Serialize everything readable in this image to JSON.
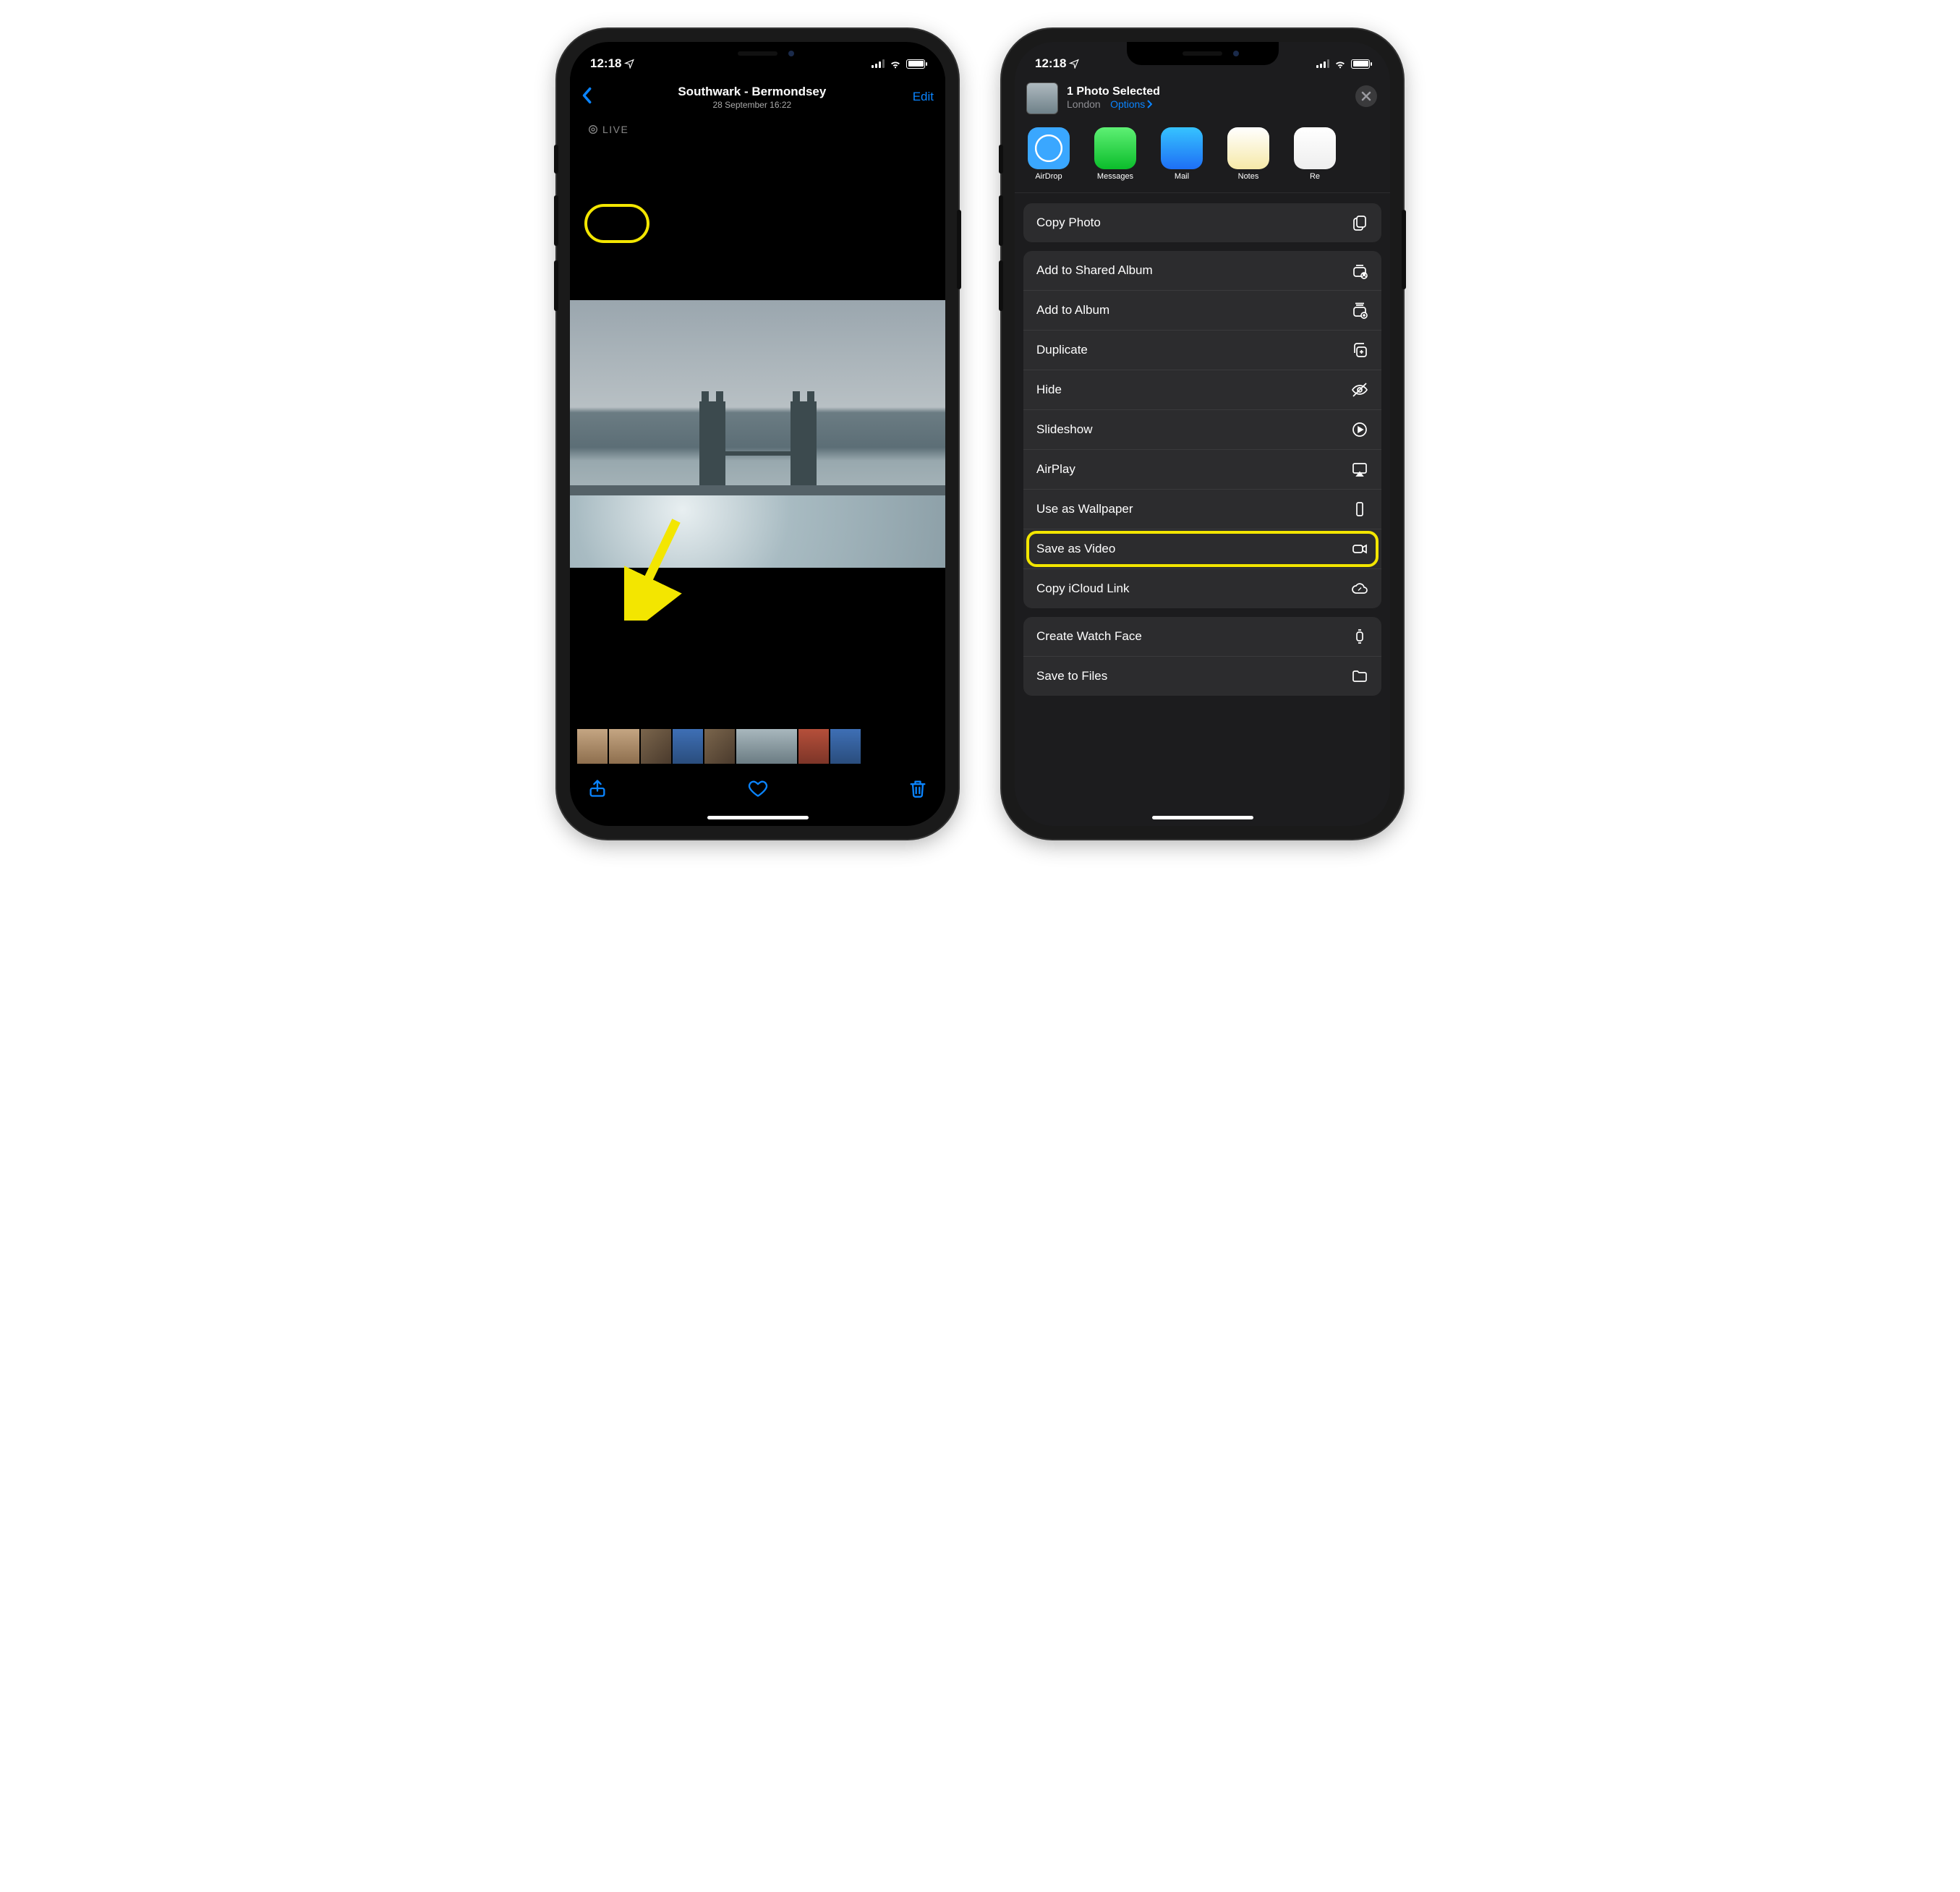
{
  "status": {
    "time": "12:18"
  },
  "left": {
    "nav": {
      "title": "Southwark - Bermondsey",
      "subtitle": "28 September  16:22",
      "edit": "Edit"
    },
    "live_badge": "LIVE"
  },
  "right": {
    "share_header": {
      "title": "1 Photo Selected",
      "location": "London",
      "options": "Options"
    },
    "apps": {
      "airdrop": "AirDrop",
      "messages": "Messages",
      "mail": "Mail",
      "notes": "Notes",
      "reminders": "Re"
    },
    "actions": {
      "copy_photo": "Copy Photo",
      "add_shared": "Add to Shared Album",
      "add_album": "Add to Album",
      "duplicate": "Duplicate",
      "hide": "Hide",
      "slideshow": "Slideshow",
      "airplay": "AirPlay",
      "wallpaper": "Use as Wallpaper",
      "save_video": "Save as Video",
      "copy_icloud": "Copy iCloud Link",
      "watch_face": "Create Watch Face",
      "save_files": "Save to Files"
    }
  }
}
